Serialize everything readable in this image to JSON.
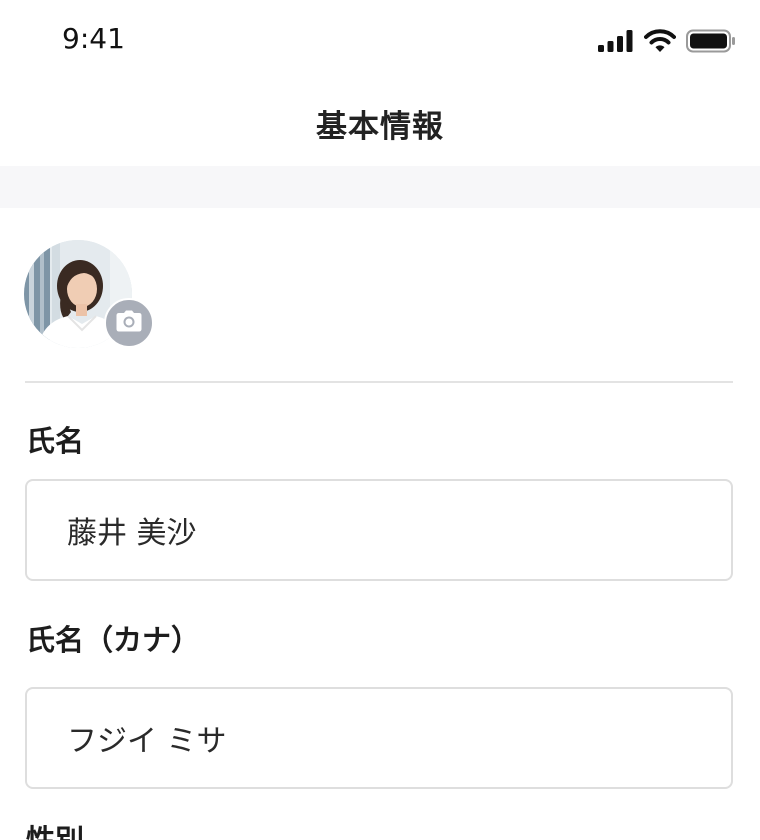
{
  "status_bar": {
    "time": "9:41"
  },
  "header": {
    "title": "基本情報"
  },
  "form": {
    "name_label": "氏名",
    "name_value": "藤井 美沙",
    "kana_label": "氏名（カナ）",
    "kana_value": "フジイ ミサ",
    "gender_label": "性別"
  },
  "icons": {
    "signal": "cellular-signal-icon",
    "wifi": "wifi-icon",
    "battery": "battery-icon",
    "camera": "camera-icon"
  },
  "colors": {
    "section_background": "#f7f7f9",
    "camera_badge": "#a9aeb8",
    "input_border": "#dedede"
  }
}
